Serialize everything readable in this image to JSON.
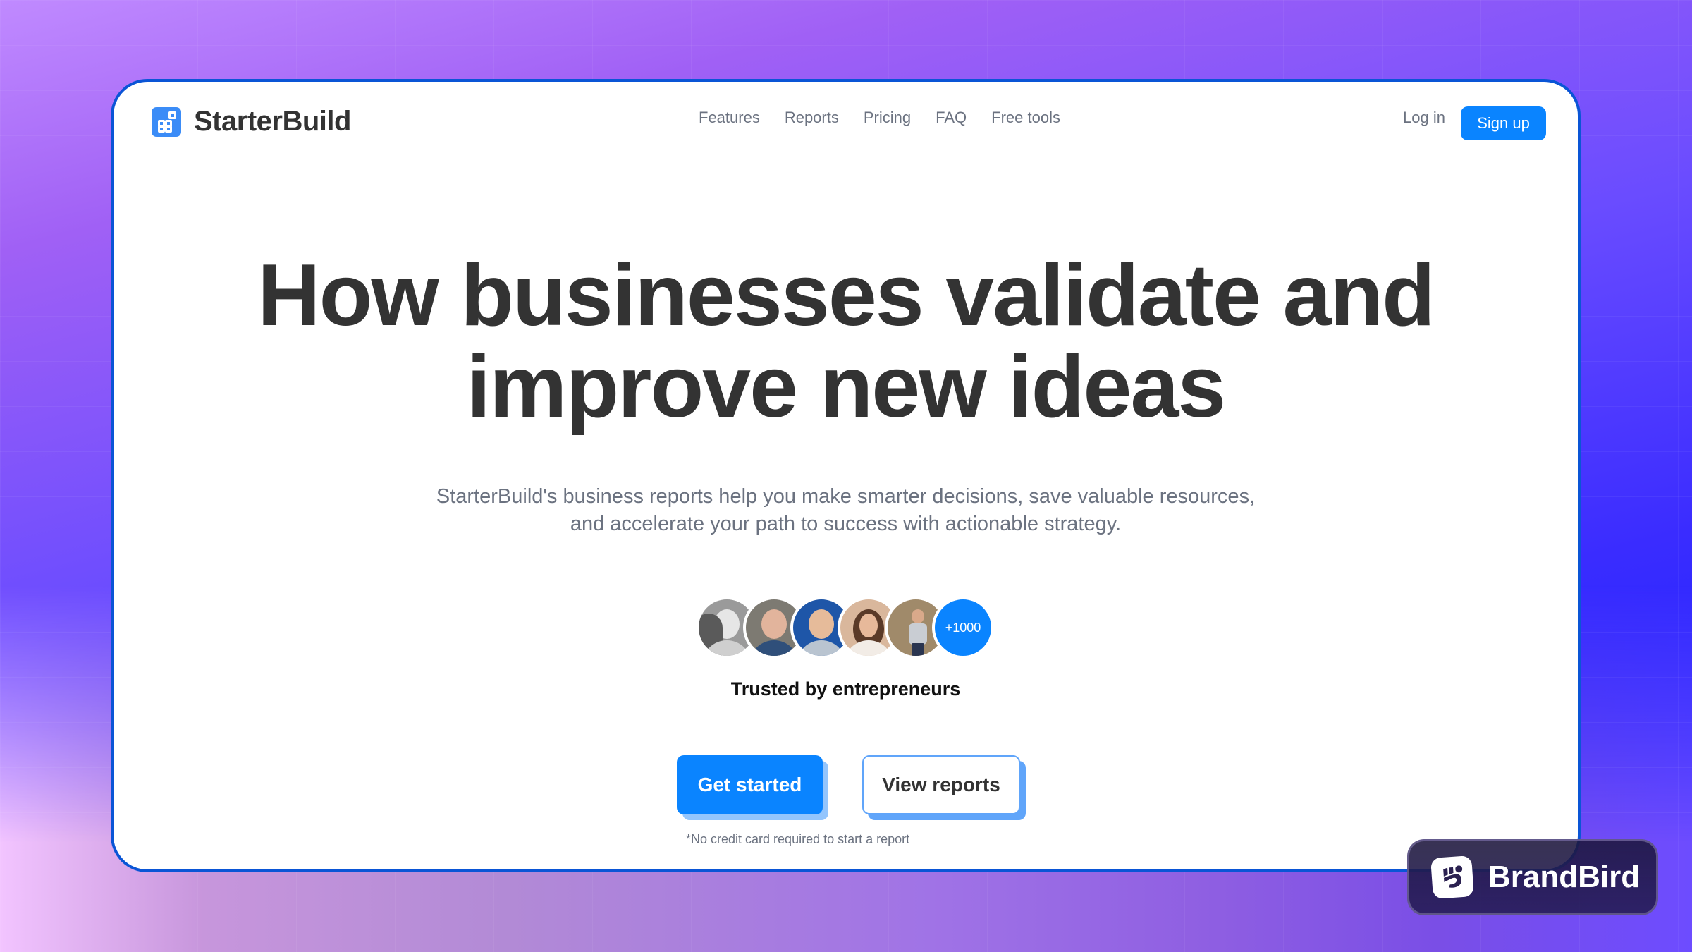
{
  "brand": {
    "name": "StarterBuild",
    "logo_icon": "grid-blocks-icon",
    "accent_color": "#0a84ff"
  },
  "nav": {
    "items": [
      "Features",
      "Reports",
      "Pricing",
      "FAQ",
      "Free tools"
    ],
    "login_label": "Log in",
    "signup_label": "Sign up"
  },
  "hero": {
    "headline_line1": "How businesses validate and",
    "headline_line2": "improve new ideas",
    "subtitle_line1": "StarterBuild's business reports help you make smarter decisions, save valuable resources,",
    "subtitle_line2": "and accelerate your path to success with actionable strategy.",
    "avatars": [
      {
        "name": "avatar-1",
        "tone": "grayscale"
      },
      {
        "name": "avatar-2",
        "tone": "color"
      },
      {
        "name": "avatar-3",
        "tone": "color"
      },
      {
        "name": "avatar-4",
        "tone": "color"
      },
      {
        "name": "avatar-5",
        "tone": "color"
      }
    ],
    "more_count": "+1000",
    "trusted_label": "Trusted by entrepreneurs",
    "primary_cta": "Get started",
    "secondary_cta": "View reports",
    "footnote": "*No credit card required to start a report"
  },
  "watermark": {
    "label": "BrandBird",
    "icon": "brandbird-logo-icon"
  }
}
